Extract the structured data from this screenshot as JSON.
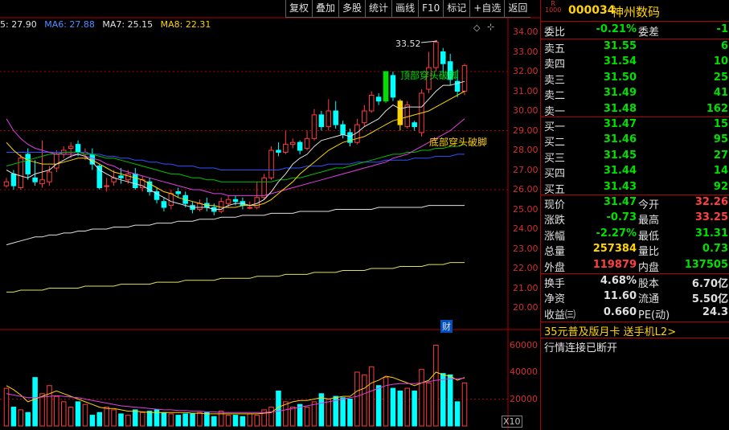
{
  "toolbar": [
    "复权",
    "叠加",
    "多股",
    "统计",
    "画线",
    "F10",
    "标记",
    "+自选",
    "返回"
  ],
  "ma": [
    {
      "label": "5: 27.90",
      "color": "#e0e0e0"
    },
    {
      "label": "MA6: 27.88",
      "color": "#ffd400"
    },
    {
      "label": "MA7: 25.15",
      "color": "#e040e0"
    },
    {
      "label": "MA8: 22.31",
      "color": "#00e000"
    }
  ],
  "price_axis": [
    "34.00",
    "33.00",
    "32.00",
    "31.00",
    "30.00",
    "29.00",
    "28.00",
    "27.00",
    "26.00",
    "25.00",
    "24.00",
    "23.00",
    "22.00",
    "21.00",
    "20.00"
  ],
  "vol_axis": [
    "60000",
    "40000",
    "20000"
  ],
  "vol_unit": "X10",
  "annotations": {
    "high": "33.52",
    "top_pattern": "顶部穿头破脚",
    "bottom_pattern": "底部穿头破脚",
    "cai": "财"
  },
  "stock": {
    "r_top": "R",
    "r_bottom": "1000",
    "code": "000034",
    "name": "神州数码"
  },
  "weibi": {
    "label": "委比",
    "value": "-0.21%",
    "label2": "委差",
    "value2": "-1"
  },
  "asks": [
    {
      "label": "卖五",
      "price": "31.55",
      "vol": "6"
    },
    {
      "label": "卖四",
      "price": "31.54",
      "vol": "10"
    },
    {
      "label": "卖三",
      "price": "31.50",
      "vol": "25"
    },
    {
      "label": "卖二",
      "price": "31.49",
      "vol": "41"
    },
    {
      "label": "卖一",
      "price": "31.48",
      "vol": "162"
    }
  ],
  "bids": [
    {
      "label": "买一",
      "price": "31.47",
      "vol": "15"
    },
    {
      "label": "买二",
      "price": "31.46",
      "vol": "95"
    },
    {
      "label": "买三",
      "price": "31.45",
      "vol": "27"
    },
    {
      "label": "买四",
      "price": "31.44",
      "vol": "14"
    },
    {
      "label": "买五",
      "price": "31.43",
      "vol": "92"
    }
  ],
  "quote": [
    {
      "l": "现价",
      "v": "31.47",
      "c1": "green",
      "l2": "今开",
      "v2": "32.26",
      "c2": "red"
    },
    {
      "l": "涨跌",
      "v": "-0.73",
      "c1": "green",
      "l2": "最高",
      "v2": "33.25",
      "c2": "red"
    },
    {
      "l": "涨幅",
      "v": "-2.27%",
      "c1": "green",
      "l2": "最低",
      "v2": "31.31",
      "c2": "green"
    },
    {
      "l": "总量",
      "v": "257384",
      "c1": "yellow",
      "l2": "量比",
      "v2": "0.73",
      "c2": "green"
    },
    {
      "l": "外盘",
      "v": "119879",
      "c1": "red",
      "l2": "内盘",
      "v2": "137505",
      "c2": "green"
    }
  ],
  "fundamentals": [
    {
      "l": "换手",
      "v": "4.68%",
      "l2": "股本",
      "v2": "6.70亿"
    },
    {
      "l": "净资",
      "v": "11.60",
      "l2": "流通",
      "v2": "5.50亿"
    },
    {
      "l": "收益㈢",
      "v": "0.660",
      "l2": "PE(动)",
      "v2": "24.3"
    }
  ],
  "promo": "35元普及版月卡 送手机L2>",
  "status": "行情连接已断开",
  "colors": {
    "up": "#ff3c3c",
    "down": "#00ffff",
    "grid": "#b00000"
  },
  "candles": [
    [
      26.2,
      26.4,
      26.1,
      26.6
    ],
    [
      26.8,
      26.2,
      26.0,
      27.0
    ],
    [
      26.1,
      27.6,
      26.0,
      27.8
    ],
    [
      27.8,
      26.8,
      26.5,
      28.1
    ],
    [
      26.6,
      26.4,
      26.2,
      27.5
    ],
    [
      26.3,
      26.5,
      26.1,
      28.5
    ],
    [
      26.4,
      26.9,
      26.2,
      27.2
    ],
    [
      27.1,
      27.8,
      26.9,
      28.0
    ],
    [
      27.8,
      28.0,
      27.6,
      28.2
    ],
    [
      28.1,
      28.2,
      27.6,
      28.4
    ],
    [
      28.3,
      27.9,
      27.7,
      28.5
    ],
    [
      27.8,
      27.9,
      27.5,
      28.1
    ],
    [
      27.8,
      27.3,
      27.0,
      28.1
    ],
    [
      27.2,
      26.1,
      26.0,
      27.3
    ],
    [
      26.2,
      26.2,
      25.9,
      26.6
    ],
    [
      26.4,
      26.6,
      26.2,
      27.0
    ],
    [
      26.7,
      26.6,
      26.3,
      27.1
    ],
    [
      26.5,
      26.8,
      26.3,
      27.0
    ],
    [
      26.8,
      26.1,
      26.0,
      27.1
    ],
    [
      26.1,
      26.5,
      25.9,
      26.7
    ],
    [
      26.4,
      25.9,
      25.7,
      26.6
    ],
    [
      25.9,
      25.5,
      25.3,
      26.1
    ],
    [
      25.4,
      25.1,
      24.9,
      25.6
    ],
    [
      25.2,
      25.8,
      25.0,
      26.0
    ],
    [
      25.9,
      25.8,
      25.6,
      26.1
    ],
    [
      25.7,
      25.3,
      25.1,
      25.9
    ],
    [
      25.2,
      25.0,
      24.8,
      25.4
    ],
    [
      25.0,
      25.3,
      24.9,
      25.5
    ],
    [
      25.3,
      25.1,
      24.9,
      25.6
    ],
    [
      25.1,
      24.9,
      24.7,
      25.3
    ],
    [
      24.9,
      25.4,
      24.8,
      25.6
    ],
    [
      25.3,
      25.5,
      25.1,
      25.7
    ],
    [
      25.5,
      25.4,
      25.2,
      25.7
    ],
    [
      25.4,
      25.2,
      25.0,
      25.6
    ],
    [
      25.1,
      25.1,
      25.0,
      25.4
    ],
    [
      25.1,
      25.6,
      25.0,
      26.4
    ],
    [
      25.6,
      26.6,
      25.5,
      26.8
    ],
    [
      26.6,
      28.0,
      26.5,
      28.2
    ],
    [
      28.0,
      27.9,
      27.7,
      28.4
    ],
    [
      27.9,
      28.3,
      27.8,
      29.0
    ],
    [
      28.3,
      28.4,
      28.1,
      28.6
    ],
    [
      28.4,
      28.0,
      27.8,
      28.5
    ],
    [
      28.1,
      28.6,
      28.0,
      29.0
    ],
    [
      28.6,
      29.8,
      28.5,
      30.1
    ],
    [
      29.8,
      29.2,
      29.0,
      30.0
    ],
    [
      29.2,
      30.0,
      29.0,
      30.6
    ],
    [
      30.0,
      29.3,
      29.1,
      30.5
    ],
    [
      29.3,
      28.8,
      28.6,
      29.5
    ],
    [
      28.9,
      28.4,
      28.2,
      29.1
    ],
    [
      28.4,
      29.3,
      28.3,
      29.6
    ],
    [
      29.4,
      30.0,
      29.2,
      30.3
    ],
    [
      30.0,
      30.8,
      29.9,
      31.0
    ],
    [
      30.7,
      30.5,
      30.3,
      30.9
    ],
    [
      30.5,
      32.0,
      30.4,
      32.0
    ],
    [
      31.8,
      30.7,
      30.5,
      32.0
    ],
    [
      30.5,
      29.3,
      29.0,
      30.6
    ],
    [
      29.2,
      30.3,
      29.1,
      30.5
    ],
    [
      29.4,
      29.2,
      29.0,
      29.5
    ],
    [
      28.9,
      30.9,
      28.7,
      31.1
    ],
    [
      31.1,
      32.2,
      30.9,
      33.0
    ],
    [
      32.2,
      33.5,
      32.0,
      33.6
    ],
    [
      33.0,
      32.4,
      31.9,
      33.2
    ],
    [
      32.5,
      31.6,
      31.3,
      32.9
    ],
    [
      31.5,
      31.0,
      30.7,
      32.1
    ],
    [
      31.0,
      32.3,
      30.8,
      32.4
    ]
  ],
  "volumes": [
    28000,
    14000,
    12000,
    10000,
    36000,
    24000,
    30000,
    22000,
    18000,
    14000,
    18000,
    16000,
    8000,
    10000,
    14000,
    12000,
    9000,
    8000,
    12000,
    10000,
    11000,
    12000,
    10000,
    9000,
    8000,
    9000,
    9000,
    10000,
    10000,
    7000,
    11000,
    8000,
    8000,
    7000,
    9000,
    8000,
    12000,
    14000,
    26000,
    18000,
    14000,
    16000,
    14000,
    18000,
    24000,
    20000,
    22000,
    21000,
    20000,
    40000,
    38000,
    44000,
    30000,
    36000,
    28000,
    26000,
    28000,
    26000,
    42000,
    32000,
    60000,
    39000,
    38000,
    18000,
    32000
  ],
  "ma_lines": {
    "ma5": [
      27.0,
      26.8,
      26.7,
      26.6,
      26.8,
      26.9,
      27.0,
      27.3,
      27.5,
      27.7,
      27.8,
      27.7,
      27.4,
      27.0,
      26.8,
      26.6,
      26.5,
      26.4,
      26.3,
      26.2,
      26.0,
      25.8,
      25.6,
      25.4,
      25.3,
      25.2,
      25.1,
      25.1,
      25.1,
      25.0,
      25.0,
      25.2,
      25.3,
      25.3,
      25.2,
      25.3,
      25.5,
      25.9,
      26.4,
      26.8,
      27.3,
      27.6,
      27.8,
      28.2,
      28.5,
      28.6,
      28.7,
      28.8,
      28.7,
      28.9,
      29.2,
      29.4,
      29.6,
      30.0,
      30.3,
      30.1,
      30.2,
      30.2,
      30.2,
      30.6,
      31.0,
      31.3,
      31.3,
      31.4,
      31.5
    ],
    "ma6": [
      28.4,
      28.0,
      27.7,
      27.5,
      27.4,
      27.3,
      27.3,
      27.3,
      27.4,
      27.5,
      27.6,
      27.6,
      27.5,
      27.3,
      27.1,
      26.9,
      26.8,
      26.7,
      26.6,
      26.5,
      26.3,
      26.1,
      25.9,
      25.8,
      25.6,
      25.5,
      25.4,
      25.3,
      25.2,
      25.2,
      25.1,
      25.1,
      25.1,
      25.2,
      25.2,
      25.2,
      25.3,
      25.5,
      25.8,
      26.1,
      26.4,
      26.8,
      27.1,
      27.4,
      27.7,
      28.0,
      28.2,
      28.4,
      28.5,
      28.6,
      28.7,
      28.9,
      29.1,
      29.3,
      29.5,
      29.6,
      29.7,
      29.8,
      29.9,
      30.0,
      30.2,
      30.4,
      30.6,
      30.8,
      31.0
    ],
    "ma7": [
      29.6,
      29.0,
      28.6,
      28.3,
      28.1,
      28.0,
      27.9,
      27.8,
      27.8,
      27.8,
      27.8,
      27.7,
      27.6,
      27.5,
      27.3,
      27.2,
      27.0,
      26.9,
      26.8,
      26.7,
      26.6,
      26.5,
      26.4,
      26.3,
      26.2,
      26.1,
      26.0,
      26.0,
      25.9,
      25.8,
      25.8,
      25.7,
      25.7,
      25.7,
      25.7,
      25.7,
      25.7,
      25.8,
      25.9,
      26.0,
      26.1,
      26.2,
      26.3,
      26.4,
      26.5,
      26.6,
      26.7,
      26.8,
      26.9,
      27.0,
      27.1,
      27.2,
      27.3,
      27.4,
      27.6,
      27.7,
      27.8,
      28.0,
      28.2,
      28.4,
      28.6,
      28.8,
      29.0,
      29.3,
      29.6
    ],
    "ma8": [
      27.2,
      27.3,
      27.4,
      27.5,
      27.6,
      27.7,
      27.8,
      27.8,
      27.9,
      27.9,
      27.9,
      27.8,
      27.8,
      27.7,
      27.6,
      27.6,
      27.5,
      27.4,
      27.3,
      27.2,
      27.1,
      27.0,
      26.9,
      26.8,
      26.8,
      26.7,
      26.6,
      26.6,
      26.5,
      26.5,
      26.4,
      26.4,
      26.4,
      26.4,
      26.4,
      26.4,
      26.4,
      26.4,
      26.5,
      26.5,
      26.6,
      26.6,
      26.7,
      26.8,
      26.9,
      27.0,
      27.1,
      27.1,
      27.2,
      27.3,
      27.4,
      27.5,
      27.6,
      27.7,
      27.8,
      27.8,
      27.9,
      27.9,
      28.0,
      28.0,
      28.1,
      28.1,
      28.2,
      28.2,
      28.3
    ],
    "blue": [
      27.9,
      27.9,
      27.9,
      27.9,
      27.9,
      27.9,
      27.9,
      27.9,
      27.9,
      27.9,
      27.9,
      27.9,
      27.8,
      27.8,
      27.7,
      27.7,
      27.6,
      27.6,
      27.5,
      27.5,
      27.4,
      27.4,
      27.3,
      27.3,
      27.2,
      27.2,
      27.2,
      27.1,
      27.1,
      27.1,
      27.0,
      27.0,
      27.0,
      27.0,
      27.0,
      27.0,
      27.0,
      27.0,
      27.0,
      27.1,
      27.1,
      27.1,
      27.2,
      27.2,
      27.2,
      27.3,
      27.3,
      27.3,
      27.3,
      27.4,
      27.4,
      27.4,
      27.4,
      27.5,
      27.5,
      27.5,
      27.5,
      27.6,
      27.6,
      27.6,
      27.7,
      27.7,
      27.7,
      27.8,
      27.8
    ],
    "white_long": [
      23.2,
      23.3,
      23.4,
      23.5,
      23.6,
      23.6,
      23.7,
      23.7,
      23.8,
      23.8,
      23.9,
      23.9,
      24.0,
      24.0,
      24.0,
      24.1,
      24.1,
      24.1,
      24.2,
      24.2,
      24.2,
      24.3,
      24.3,
      24.3,
      24.4,
      24.4,
      24.4,
      24.5,
      24.5,
      24.5,
      24.6,
      24.6,
      24.6,
      24.7,
      24.7,
      24.7,
      24.7,
      24.8,
      24.8,
      24.8,
      24.8,
      24.9,
      24.9,
      24.9,
      24.9,
      24.9,
      25.0,
      25.0,
      25.0,
      25.0,
      25.0,
      25.0,
      25.1,
      25.1,
      25.1,
      25.1,
      25.1,
      25.1,
      25.1,
      25.2,
      25.2,
      25.2,
      25.2,
      25.2,
      25.2
    ],
    "yellow_long": [
      20.8,
      20.8,
      20.9,
      20.9,
      20.9,
      20.9,
      21.0,
      21.0,
      21.0,
      21.0,
      21.0,
      21.1,
      21.1,
      21.1,
      21.1,
      21.1,
      21.2,
      21.2,
      21.2,
      21.2,
      21.2,
      21.3,
      21.3,
      21.3,
      21.3,
      21.4,
      21.4,
      21.4,
      21.4,
      21.4,
      21.5,
      21.5,
      21.5,
      21.5,
      21.5,
      21.6,
      21.6,
      21.6,
      21.6,
      21.7,
      21.7,
      21.7,
      21.7,
      21.8,
      21.8,
      21.8,
      21.8,
      21.9,
      21.9,
      21.9,
      21.9,
      22.0,
      22.0,
      22.0,
      22.0,
      22.1,
      22.1,
      22.1,
      22.1,
      22.2,
      22.2,
      22.2,
      22.3,
      22.3,
      22.3
    ],
    "vol_ma1": [
      30000,
      27000,
      23000,
      18000,
      20000,
      22000,
      24000,
      26000,
      24000,
      22000,
      20000,
      18000,
      16000,
      14000,
      13000,
      13000,
      12000,
      11000,
      11000,
      10500,
      10000,
      10000,
      10000,
      10000,
      10000,
      10000,
      9500,
      9500,
      9000,
      9000,
      9000,
      9000,
      9000,
      9000,
      9000,
      9000,
      9500,
      10000,
      14000,
      16000,
      18000,
      19000,
      19000,
      20000,
      21000,
      20000,
      21000,
      22000,
      22000,
      26000,
      28000,
      32000,
      34000,
      37000,
      36000,
      34000,
      32000,
      30000,
      32000,
      34000,
      40000,
      38000,
      37000,
      34000,
      36000
    ],
    "vol_ma2": [
      24000,
      23000,
      22000,
      21000,
      21000,
      21500,
      22000,
      22500,
      22000,
      21500,
      21000,
      20000,
      19000,
      18000,
      17000,
      16000,
      15000,
      14500,
      14000,
      13500,
      13000,
      12500,
      12000,
      12000,
      11500,
      11500,
      11000,
      11000,
      10500,
      10500,
      10000,
      10000,
      10000,
      10000,
      10000,
      10000,
      10000,
      10500,
      11000,
      12000,
      13000,
      14000,
      15000,
      16000,
      17000,
      18000,
      19000,
      20000,
      21000,
      22000,
      24000,
      26000,
      28000,
      30000,
      31000,
      31500,
      31500,
      31500,
      32000,
      33000,
      34000,
      34500,
      35000,
      35000,
      35500
    ]
  }
}
